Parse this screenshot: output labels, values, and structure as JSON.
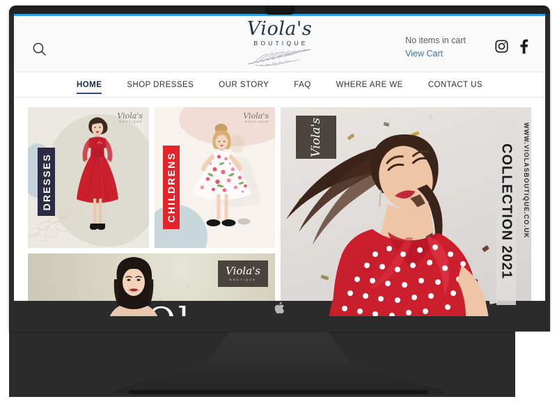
{
  "device": {
    "brand_icon": "apple-logo-icon",
    "frame_color": "#2b2b2b",
    "screen_accent_color": "#2f9fe0"
  },
  "site": {
    "header": {
      "search_icon": "search-icon",
      "logo": {
        "name": "Viola's",
        "tagline": "BOUTIQUE",
        "feather_icon": "feather-icon",
        "color": "#20354e"
      },
      "cart": {
        "status": "No items in cart",
        "link_label": "View Cart",
        "link_color": "#3c6ea5"
      },
      "social": [
        {
          "name": "instagram-icon",
          "label": "Instagram"
        },
        {
          "name": "facebook-icon",
          "label": "Facebook"
        }
      ]
    },
    "nav": {
      "active": "HOME",
      "items": [
        {
          "label": "HOME",
          "active": true
        },
        {
          "label": "SHOP DRESSES",
          "active": false
        },
        {
          "label": "OUR STORY",
          "active": false
        },
        {
          "label": "FAQ",
          "active": false
        },
        {
          "label": "WHERE ARE WE",
          "active": false
        },
        {
          "label": "CONTACT US",
          "active": false
        }
      ],
      "active_underline_color": "#2d4e8a"
    },
    "tiles": [
      {
        "id": "dresses",
        "label": "DRESSES",
        "label_bg": "#2c2b43",
        "watermark": "Viola's",
        "watermark_sub": "BOUTIQUE",
        "bg": "#ece9e3"
      },
      {
        "id": "childrens",
        "label": "CHILDRENS",
        "label_bg": "#e3242b",
        "watermark": "Viola's",
        "watermark_sub": "BOUTIQUE",
        "bg": "#f7f2ee"
      }
    ],
    "banner": {
      "logo_name": "Viola's",
      "logo_sub": "BOUTIQUE",
      "headline": "Ol"
    },
    "hero": {
      "logo_name": "Viola's",
      "band_text": "COLLECTION 2021",
      "url_text": "WWW.VIOLASBOUTIQUE.CO.UK",
      "band_bg": "#dfdddb"
    }
  }
}
